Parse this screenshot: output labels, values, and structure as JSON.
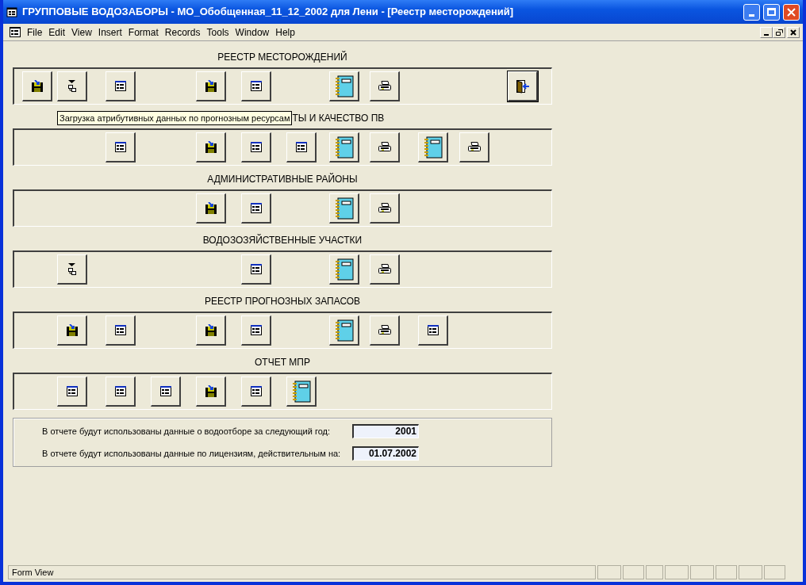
{
  "window": {
    "title": "ГРУППОВЫЕ ВОДОЗАБОРЫ - МО_Обобщенная_11_12_2002 для Лени - [Реестр месторождений]"
  },
  "menu": [
    "File",
    "Edit",
    "View",
    "Insert",
    "Format",
    "Records",
    "Tools",
    "Window",
    "Help"
  ],
  "sections": [
    {
      "title": "РЕЕСТР МЕСТОРОЖДЕНИЙ",
      "slots": [
        {
          "kind": "save"
        },
        {
          "kind": "filter"
        },
        {
          "kind": "form"
        },
        {
          "kind": "empty"
        },
        {
          "kind": "save"
        },
        {
          "kind": "form"
        },
        {
          "kind": "empty"
        },
        {
          "kind": "notebook"
        },
        {
          "kind": "print"
        },
        {
          "kind": "empty"
        },
        {
          "kind": "empty"
        },
        {
          "kind": "exit"
        }
      ]
    },
    {
      "title": "ТЫ И КАЧЕСТВО ПВ",
      "tooltip": "Загрузка атрибутивных данных по прогнозным ресурсам",
      "slots": [
        {
          "kind": "empty"
        },
        {
          "kind": "empty"
        },
        {
          "kind": "form"
        },
        {
          "kind": "empty"
        },
        {
          "kind": "save"
        },
        {
          "kind": "form"
        },
        {
          "kind": "form"
        },
        {
          "kind": "notebook"
        },
        {
          "kind": "print"
        },
        {
          "kind": "notebook"
        },
        {
          "kind": "print"
        }
      ]
    },
    {
      "title": "АДМИНИСТРАТИВНЫЕ РАЙОНЫ",
      "slots": [
        {
          "kind": "empty"
        },
        {
          "kind": "empty"
        },
        {
          "kind": "empty"
        },
        {
          "kind": "empty"
        },
        {
          "kind": "save"
        },
        {
          "kind": "form"
        },
        {
          "kind": "empty"
        },
        {
          "kind": "notebook"
        },
        {
          "kind": "print"
        }
      ]
    },
    {
      "title": "ВОДОЗОЗЯЙСТВЕННЫЕ УЧАСТКИ",
      "slots": [
        {
          "kind": "empty"
        },
        {
          "kind": "filter"
        },
        {
          "kind": "empty"
        },
        {
          "kind": "empty"
        },
        {
          "kind": "empty"
        },
        {
          "kind": "form"
        },
        {
          "kind": "empty"
        },
        {
          "kind": "notebook"
        },
        {
          "kind": "print"
        }
      ]
    },
    {
      "title": "РЕЕСТР ПРОГНОЗНЫХ ЗАПАСОВ",
      "slots": [
        {
          "kind": "empty"
        },
        {
          "kind": "save"
        },
        {
          "kind": "form"
        },
        {
          "kind": "empty"
        },
        {
          "kind": "save"
        },
        {
          "kind": "form"
        },
        {
          "kind": "empty"
        },
        {
          "kind": "notebook"
        },
        {
          "kind": "print"
        },
        {
          "kind": "form"
        }
      ]
    },
    {
      "title": "ОТЧЕТ МПР",
      "slots": [
        {
          "kind": "empty"
        },
        {
          "kind": "form"
        },
        {
          "kind": "form"
        },
        {
          "kind": "form"
        },
        {
          "kind": "save"
        },
        {
          "kind": "form"
        },
        {
          "kind": "notebook"
        }
      ]
    }
  ],
  "info": [
    {
      "label": "В отчете будут использованы данные о водоотборе за следующий год:",
      "value": "2001"
    },
    {
      "label": "В отчете будут использованы данные по лицензиям, действительным на:",
      "value": "01.07.2002"
    }
  ],
  "status_bar": "Form View"
}
